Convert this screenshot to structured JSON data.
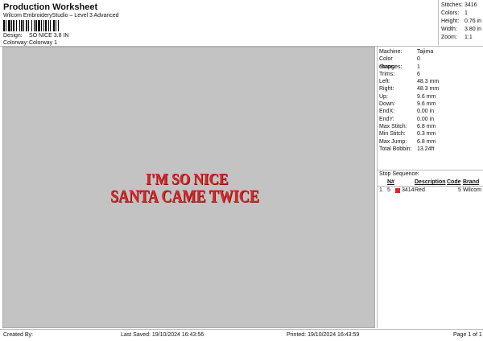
{
  "header": {
    "title": "Production Worksheet",
    "subtitle": "Wilcom EmbroideryStudio – Level 3 Advanced",
    "design_label": "Design:",
    "design_value": "SO NICE 3.8 IN",
    "colorway_label": "Colorway:",
    "colorway_value": "Colorway 1"
  },
  "stats": [
    {
      "label": "Stitches:",
      "value": "3416"
    },
    {
      "label": "Colors:",
      "value": "1"
    },
    {
      "label": "Height:",
      "value": "0.76 in"
    },
    {
      "label": "Width:",
      "value": "3.80 in"
    },
    {
      "label": "Zoom:",
      "value": "1:1"
    }
  ],
  "design_text": {
    "line1": "I'M SO NICE",
    "line2": "SANTA CAME TWICE",
    "color": "#d22a2a"
  },
  "machine": [
    {
      "label": "Machine:",
      "value": "Tajima"
    },
    {
      "label": "Color changes:",
      "value": "0"
    },
    {
      "label": "Stops:",
      "value": "1"
    },
    {
      "label": "Trims:",
      "value": "6"
    },
    {
      "label": "Left:",
      "value": "48.3 mm"
    },
    {
      "label": "Right:",
      "value": "48.3 mm"
    },
    {
      "label": "Up:",
      "value": "9.6 mm"
    },
    {
      "label": "Down:",
      "value": "9.6 mm"
    },
    {
      "label": "EndX:",
      "value": "0.00 in"
    },
    {
      "label": "EndY:",
      "value": "0.00 in"
    },
    {
      "label": "Max Stitch:",
      "value": "6.8 mm"
    },
    {
      "label": "Min Stitch:",
      "value": "0.3 mm"
    },
    {
      "label": "Max Jump:",
      "value": "6.8 mm"
    },
    {
      "label": "Total Bobbin:",
      "value": "13.24ft"
    }
  ],
  "stop_sequence": {
    "title": "Stop Sequence:",
    "headers": {
      "index": "N#",
      "description": "Description",
      "code": "Code",
      "brand": "Brand"
    },
    "rows": [
      {
        "stop": "1.",
        "index": "5",
        "stitches": "3414",
        "description": "Red",
        "code": "5",
        "brand": "Wilcom",
        "color": "#d22a2a"
      }
    ]
  },
  "footer": {
    "created": "Created By:",
    "last_saved": "Last Saved: 19/10/2024 16:43:56",
    "printed": "Printed: 19/10/2024 16:43:59",
    "page": "Page 1 of 1"
  }
}
